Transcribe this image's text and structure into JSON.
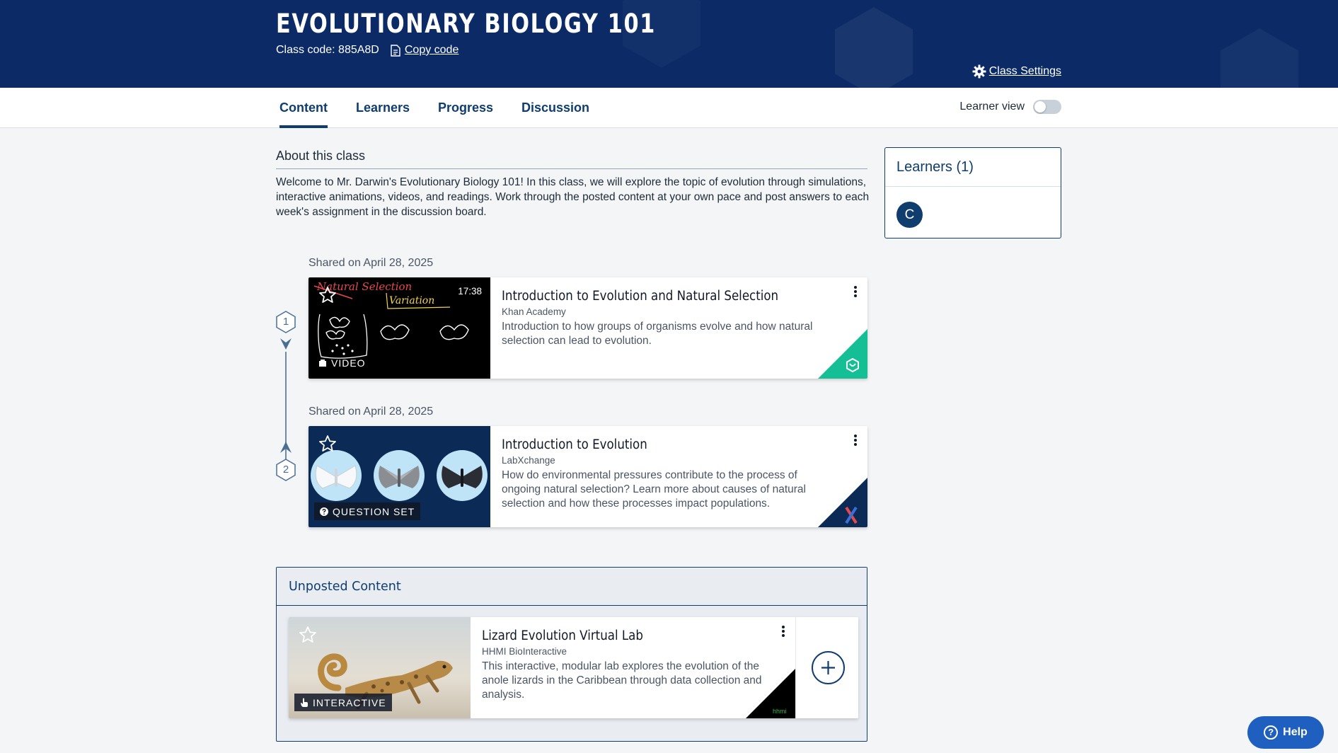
{
  "header": {
    "title": "EVOLUTIONARY BIOLOGY 101",
    "class_code": "Class code: 885A8D",
    "copy_code": "Copy code",
    "settings": "Class Settings"
  },
  "tabs": [
    {
      "label": "Content",
      "active": true
    },
    {
      "label": "Learners",
      "active": false
    },
    {
      "label": "Progress",
      "active": false
    },
    {
      "label": "Discussion",
      "active": false
    }
  ],
  "learner_view": {
    "label": "Learner view",
    "enabled": false
  },
  "about": {
    "heading": "About this class",
    "text": "Welcome to Mr. Darwin's Evolutionary Biology 101! In this class, we will explore the topic of evolution through simulations, interactive animations, videos, and readings. Work through the posted content at your own pace and post answers to each week's assignment in the discussion board."
  },
  "learners_panel": {
    "title": "Learners (1)",
    "avatar_initial": "C"
  },
  "posted": [
    {
      "step": "1",
      "shared": "Shared on April 28, 2025",
      "title": "Introduction to Evolution and Natural Selection",
      "source": "Khan Academy",
      "description": "Introduction to how groups of organisms evolve and how natural selection can lead to evolution.",
      "type": "VIDEO",
      "duration": "17:38",
      "thumb_words": [
        "Natural Selection",
        "Variation"
      ]
    },
    {
      "step": "2",
      "shared": "Shared on April 28, 2025",
      "title": "Introduction to Evolution",
      "source": "LabXchange",
      "description": "How do environmental pressures contribute to the process of ongoing natural selection? Learn more about causes of natural selection and how these processes impact populations.",
      "type": "QUESTION SET"
    }
  ],
  "unposted": {
    "heading": "Unposted Content",
    "item": {
      "title": "Lizard Evolution Virtual Lab",
      "source": "HHMI BioInteractive",
      "description": "This interactive, modular lab explores the evolution of the anole lizards in the Caribbean through data collection and analysis.",
      "type": "INTERACTIVE",
      "corner_text": "hhmi"
    }
  },
  "help": {
    "label": "Help"
  },
  "colors": {
    "navy": "#0b2a66",
    "accent": "#0f3d6e",
    "khan_green": "#14bf96",
    "labx_navy": "#0b2a55",
    "help_blue": "#1f5fbf"
  }
}
